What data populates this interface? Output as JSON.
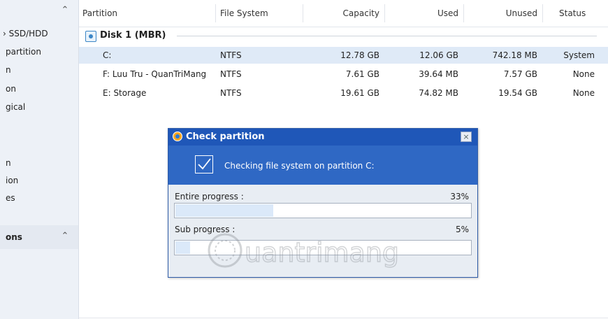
{
  "sidebar": {
    "items": [
      {
        "label": "› SSD/HDD"
      },
      {
        "label": "partition"
      },
      {
        "label": "n"
      },
      {
        "label": "on"
      },
      {
        "label": "gical"
      },
      {
        "label": "n"
      },
      {
        "label": "ion"
      },
      {
        "label": "es"
      }
    ],
    "section_label": "ons"
  },
  "table": {
    "headers": [
      "Partition",
      "File System",
      "Capacity",
      "Used",
      "Unused",
      "Status"
    ],
    "disk_label": "Disk 1 (MBR)",
    "rows": [
      {
        "partition": "C:",
        "fs": "NTFS",
        "capacity": "12.78 GB",
        "used": "12.06 GB",
        "unused": "742.18 MB",
        "status": "System"
      },
      {
        "partition": "F: Luu Tru - QuanTriMang",
        "fs": "NTFS",
        "capacity": "7.61 GB",
        "used": "39.64 MB",
        "unused": "7.57 GB",
        "status": "None"
      },
      {
        "partition": "E: Storage",
        "fs": "NTFS",
        "capacity": "19.61 GB",
        "used": "74.82 MB",
        "unused": "19.54 GB",
        "status": "None"
      }
    ]
  },
  "dialog": {
    "title": "Check partition",
    "close_glyph": "×",
    "banner_text": "Checking file system on partition C:",
    "entire_label": "Entire progress :",
    "entire_percent": "33%",
    "entire_fraction": 0.33,
    "sub_label": "Sub progress :",
    "sub_percent": "5%",
    "sub_fraction": 0.05
  },
  "watermark": "uantrimang",
  "colors": {
    "title_bar": "#1f57b8",
    "banner": "#2f68c4",
    "selected_row": "#dfeaf7",
    "progress_fill": "#dbe9f9"
  }
}
